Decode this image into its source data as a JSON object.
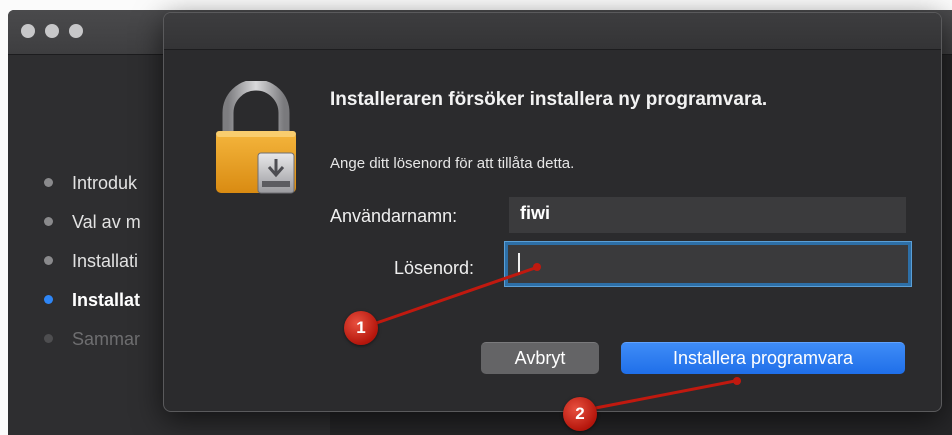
{
  "sidebar": {
    "items": [
      {
        "label": "Introduk",
        "state": "normal"
      },
      {
        "label": "Val av m",
        "state": "normal"
      },
      {
        "label": "Installati",
        "state": "normal"
      },
      {
        "label": "Installat",
        "state": "active"
      },
      {
        "label": "Sammar",
        "state": "dim"
      }
    ]
  },
  "dialog": {
    "title": "Installeraren försöker installera ny programvara.",
    "subtitle": "Ange ditt lösenord för att tillåta detta.",
    "username_label": "Användarnamn:",
    "username_value": "fiwi",
    "password_label": "Lösenord:",
    "password_value": "",
    "cancel_label": "Avbryt",
    "install_label": "Installera programvara"
  },
  "annotations": {
    "marker_1": "1",
    "marker_2": "2"
  },
  "icons": {
    "dialog_icon": "padlock-with-installer-icon",
    "window_controls": "traffic-light-dots"
  },
  "colors": {
    "accent": "#2e86f6",
    "marker_red": "#c0190f",
    "focus_ring": "#2d6fa7"
  }
}
